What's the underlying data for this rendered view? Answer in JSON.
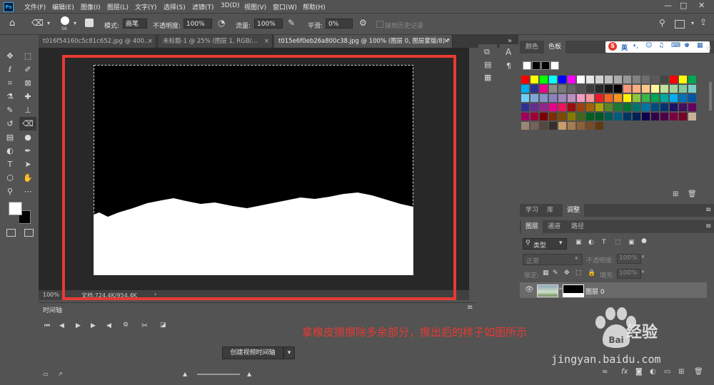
{
  "menu": {
    "logo": "Ps",
    "items": [
      "文件(F)",
      "编辑(E)",
      "图像(I)",
      "图层(L)",
      "文字(Y)",
      "选择(S)",
      "滤镜(T)",
      "3D(D)",
      "视图(V)",
      "窗口(W)",
      "帮助(H)"
    ],
    "window_controls": [
      "—",
      "□",
      "✕"
    ]
  },
  "options": {
    "brush_size": "56",
    "mode_label": "模式:",
    "mode_value": "画笔",
    "opacity_label": "不透明度:",
    "opacity_value": "100%",
    "flow_label": "流量:",
    "flow_value": "100%",
    "smooth_label": "平滑:",
    "smooth_value": "0%",
    "history_label": "抹到历史记录"
  },
  "tabs": [
    {
      "label": "t016f54160c5c81c652.jpg @ 400..."
    },
    {
      "label": "未标题-1 @ 25% (图层 1, RGB/..."
    },
    {
      "label": "t015e6f0eb26a800c38.jpg @ 100% (图层 0, 图层蒙版/8) *"
    }
  ],
  "status": {
    "zoom": "100%",
    "doc_size": "文档:724.4K/954.4K"
  },
  "timeline": {
    "title": "时间轴",
    "create_button": "创建视频时间轴"
  },
  "swatches_panel": {
    "tabs": [
      "颜色",
      "色板"
    ],
    "ime_label": "英",
    "colors": [
      [
        "#ff0000",
        "#ffff00",
        "#00ff00",
        "#00ffff",
        "#0000ff",
        "#ff00ff",
        "#ffffff",
        "#e6e6e6",
        "#d2d2d2",
        "#bebebe",
        "#aaaaaa",
        "#969696",
        "#828282",
        "#6e6e6e",
        "#5a5a5a",
        "#464646",
        "#ff0000",
        "#ffff00",
        "#00a651"
      ],
      [
        "#00aeef",
        "#2e3192",
        "#ec008c",
        "#8c8c8c",
        "#787878",
        "#646464",
        "#505050",
        "#3c3c3c",
        "#282828",
        "#141414",
        "#000000",
        "#f7977a",
        "#f9ad81",
        "#fdc68a",
        "#fff79a",
        "#c4df9b",
        "#a3d39c",
        "#82ca9d",
        "#7bcdc8"
      ],
      [
        "#6ecff6",
        "#7ea7d8",
        "#8493ca",
        "#8882be",
        "#a187be",
        "#bc8dbf",
        "#f49ac2",
        "#f6989d",
        "#ed1c24",
        "#f26522",
        "#f7941d",
        "#fff200",
        "#8dc73f",
        "#39b54a",
        "#00a651",
        "#00a99d",
        "#00aeef",
        "#0072bc",
        "#0054a6"
      ],
      [
        "#2e3192",
        "#662d91",
        "#92278f",
        "#ec008c",
        "#ed145b",
        "#9e0b0f",
        "#a0410d",
        "#a36209",
        "#aba000",
        "#598527",
        "#1a7b30",
        "#007236",
        "#00746b",
        "#0076a3",
        "#004b80",
        "#003471",
        "#1b1464",
        "#440e62",
        "#630460"
      ],
      [
        "#9e005d",
        "#9e0039",
        "#790000",
        "#7b2e00",
        "#7d4900",
        "#827b00",
        "#406618",
        "#005e20",
        "#005826",
        "#005952",
        "#005b7f",
        "#003663",
        "#002157",
        "#0d004c",
        "#32004b",
        "#4b0049",
        "#7b0046",
        "#7a0026",
        "#c7b299"
      ],
      [
        "#998675",
        "#736357",
        "#534741",
        "#362f2d",
        "#c69c6d",
        "#a67c52",
        "#8c6239",
        "#754c24",
        "#603913"
      ]
    ]
  },
  "learn_tabs": [
    "学习",
    "库",
    "调整"
  ],
  "layers": {
    "tabs": [
      "图层",
      "通道",
      "路径"
    ],
    "filter_kind": "类型",
    "blend_mode": "正常",
    "opacity_label": "不透明度:",
    "opacity_value": "100%",
    "lock_label": "锁定:",
    "fill_label": "填充:",
    "fill_value": "100%",
    "layer_name": "图层 0"
  },
  "annotation": "拿橡皮擦擦除多余部分，擦出后的样子如图所示",
  "watermark": {
    "brand": "Bai",
    "name": "经验",
    "url": "jingyan.baidu.com"
  }
}
